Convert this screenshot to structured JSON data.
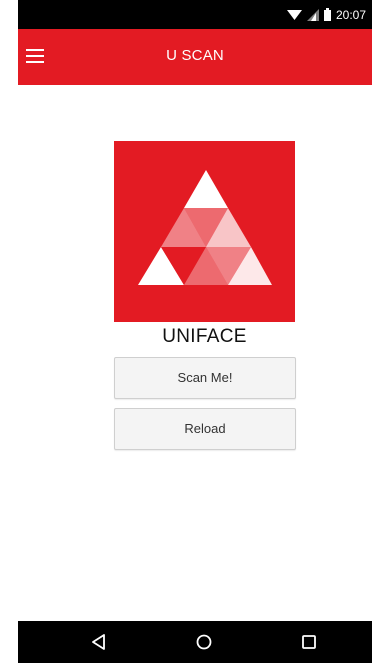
{
  "status_bar": {
    "time": "20:07",
    "icons": [
      "wifi-icon",
      "signal-icon",
      "battery-icon"
    ]
  },
  "app_bar": {
    "title": "U SCAN",
    "menu_icon": "hamburger-menu-icon",
    "color": "#e31b23"
  },
  "logo": {
    "brand_name": "UNIFACE",
    "icon": "uniface-triangle-logo",
    "background": "#e31b23"
  },
  "buttons": {
    "scan_label": "Scan Me!",
    "reload_label": "Reload"
  },
  "nav_bar": {
    "items": [
      "back-icon",
      "home-icon",
      "recents-icon"
    ]
  }
}
